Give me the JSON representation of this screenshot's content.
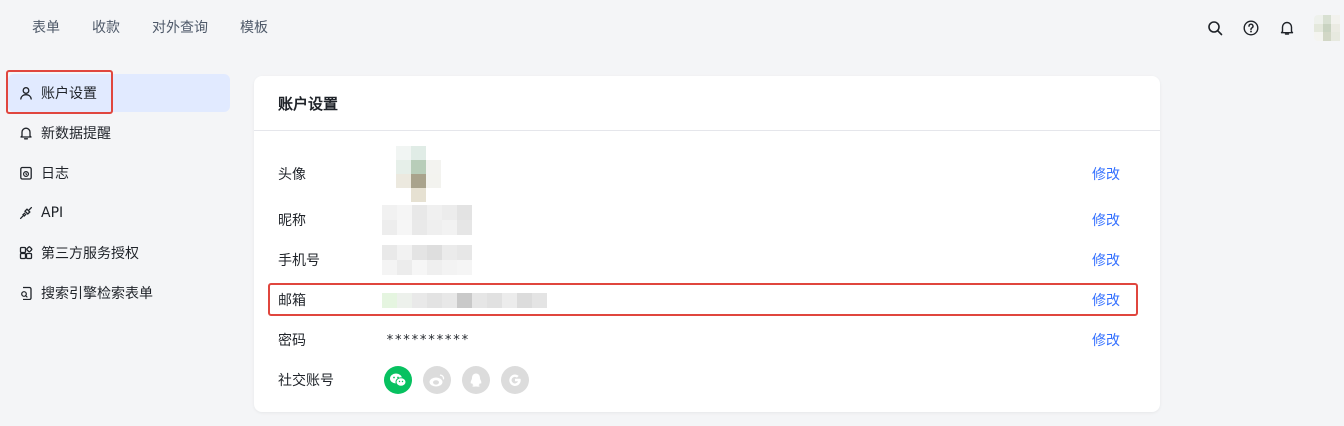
{
  "top_nav": [
    "表单",
    "收款",
    "对外查询",
    "模板"
  ],
  "top_actions": {
    "search_icon": "search-icon",
    "help_icon": "help-icon",
    "bell_icon": "bell-icon"
  },
  "sidebar": {
    "items": [
      {
        "label": "账户设置",
        "icon": "user-icon",
        "active": true
      },
      {
        "label": "新数据提醒",
        "icon": "bell-icon"
      },
      {
        "label": "日志",
        "icon": "log-icon"
      },
      {
        "label": "API",
        "icon": "api-icon"
      },
      {
        "label": "第三方服务授权",
        "icon": "apps-icon"
      },
      {
        "label": "搜索引擎检索表单",
        "icon": "search-form-icon"
      }
    ]
  },
  "card": {
    "title": "账户设置",
    "rows": [
      {
        "label": "头像",
        "action": "修改"
      },
      {
        "label": "昵称",
        "action": "修改"
      },
      {
        "label": "手机号",
        "action": "修改"
      },
      {
        "label": "邮箱",
        "action": "修改"
      },
      {
        "label": "密码",
        "value": "**********",
        "action": "修改"
      },
      {
        "label": "社交账号"
      }
    ],
    "socials": [
      "wechat-icon",
      "weibo-icon",
      "qq-icon",
      "google-icon"
    ]
  },
  "colors": {
    "accent": "#3370ff",
    "highlight": "#e0463e",
    "wechat": "#07c160",
    "inactive_social": "#dcdcdc"
  }
}
